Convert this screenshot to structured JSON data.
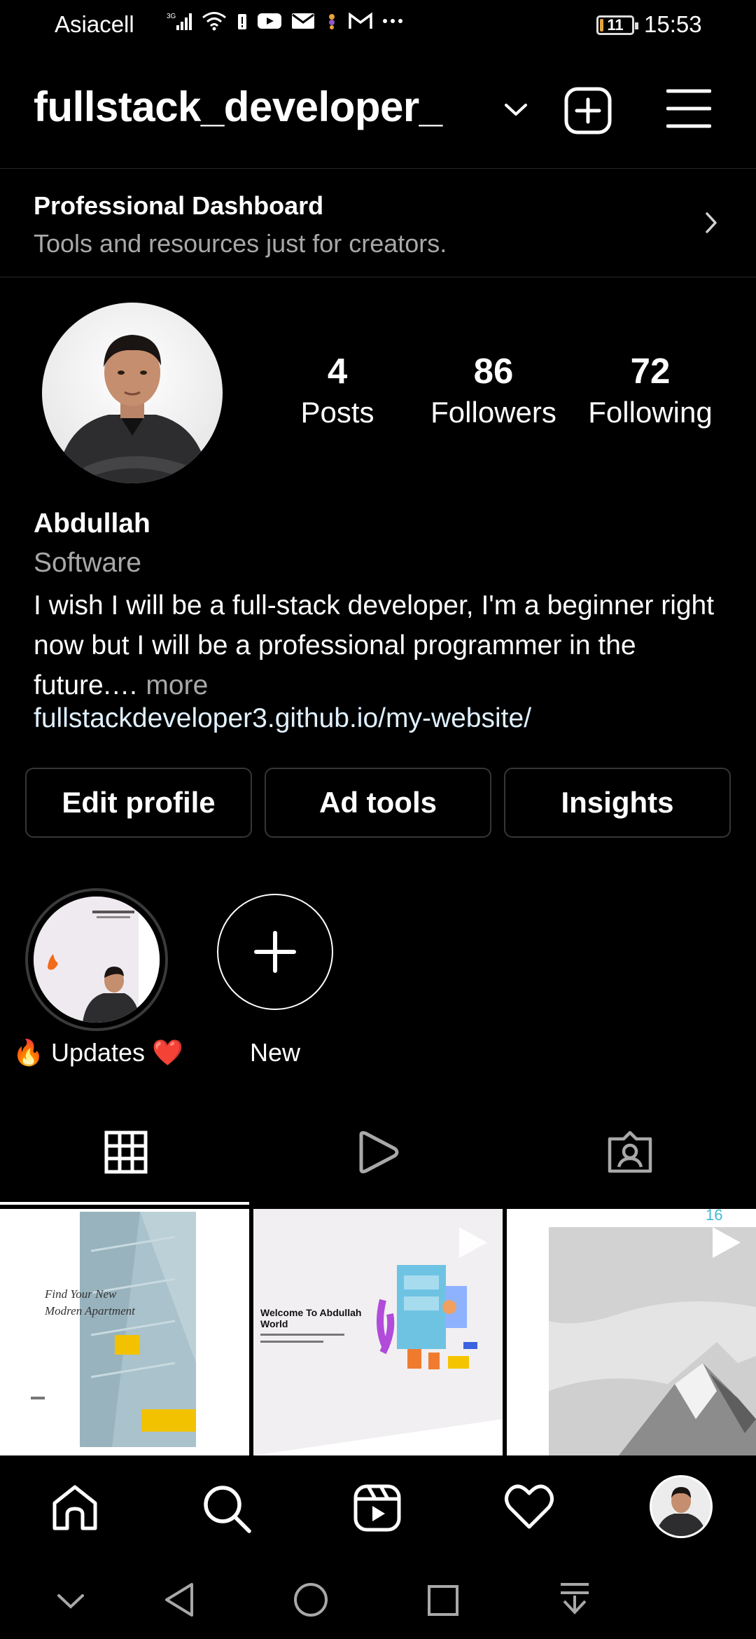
{
  "status_bar": {
    "carrier": "Asiacell",
    "network": "3G",
    "battery": "11",
    "battery_level": 0.11,
    "time": "15:53"
  },
  "header": {
    "username": "fullstack_developer_",
    "icons": [
      "chevron-down-icon",
      "add-post-icon",
      "menu-icon"
    ]
  },
  "dashboard": {
    "title": "Professional Dashboard",
    "subtitle": "Tools and resources just for creators."
  },
  "stats": {
    "posts": {
      "value": "4",
      "label": "Posts"
    },
    "followers": {
      "value": "86",
      "label": "Followers"
    },
    "following": {
      "value": "72",
      "label": "Following"
    }
  },
  "profile": {
    "name": "Abdullah",
    "category": "Software",
    "bio": "I wish I will be a full-stack developer, I'm a beginner right now but I will be a professional programmer in the future.…",
    "more": " more",
    "link": "fullstackdeveloper3.github.io/my-website/"
  },
  "buttons": {
    "edit_profile": "Edit profile",
    "ad_tools": "Ad tools",
    "insights": "Insights"
  },
  "highlights": [
    {
      "label": "🔥 Updates ❤️"
    },
    {
      "label": "New"
    }
  ],
  "tabs": [
    "grid-icon",
    "reels-icon",
    "tagged-icon"
  ],
  "posts": [
    {
      "headline": "Find Your New Modren Apartment"
    },
    {
      "headline": "Welcome To Abdullah World"
    },
    {
      "headline": "16"
    }
  ],
  "bottom_nav": [
    "home-icon",
    "search-icon",
    "reels-icon",
    "heart-icon",
    "profile-avatar"
  ],
  "system_nav": [
    "collapse-icon",
    "back-icon",
    "home-circle-icon",
    "recents-icon",
    "notification-down-icon"
  ]
}
